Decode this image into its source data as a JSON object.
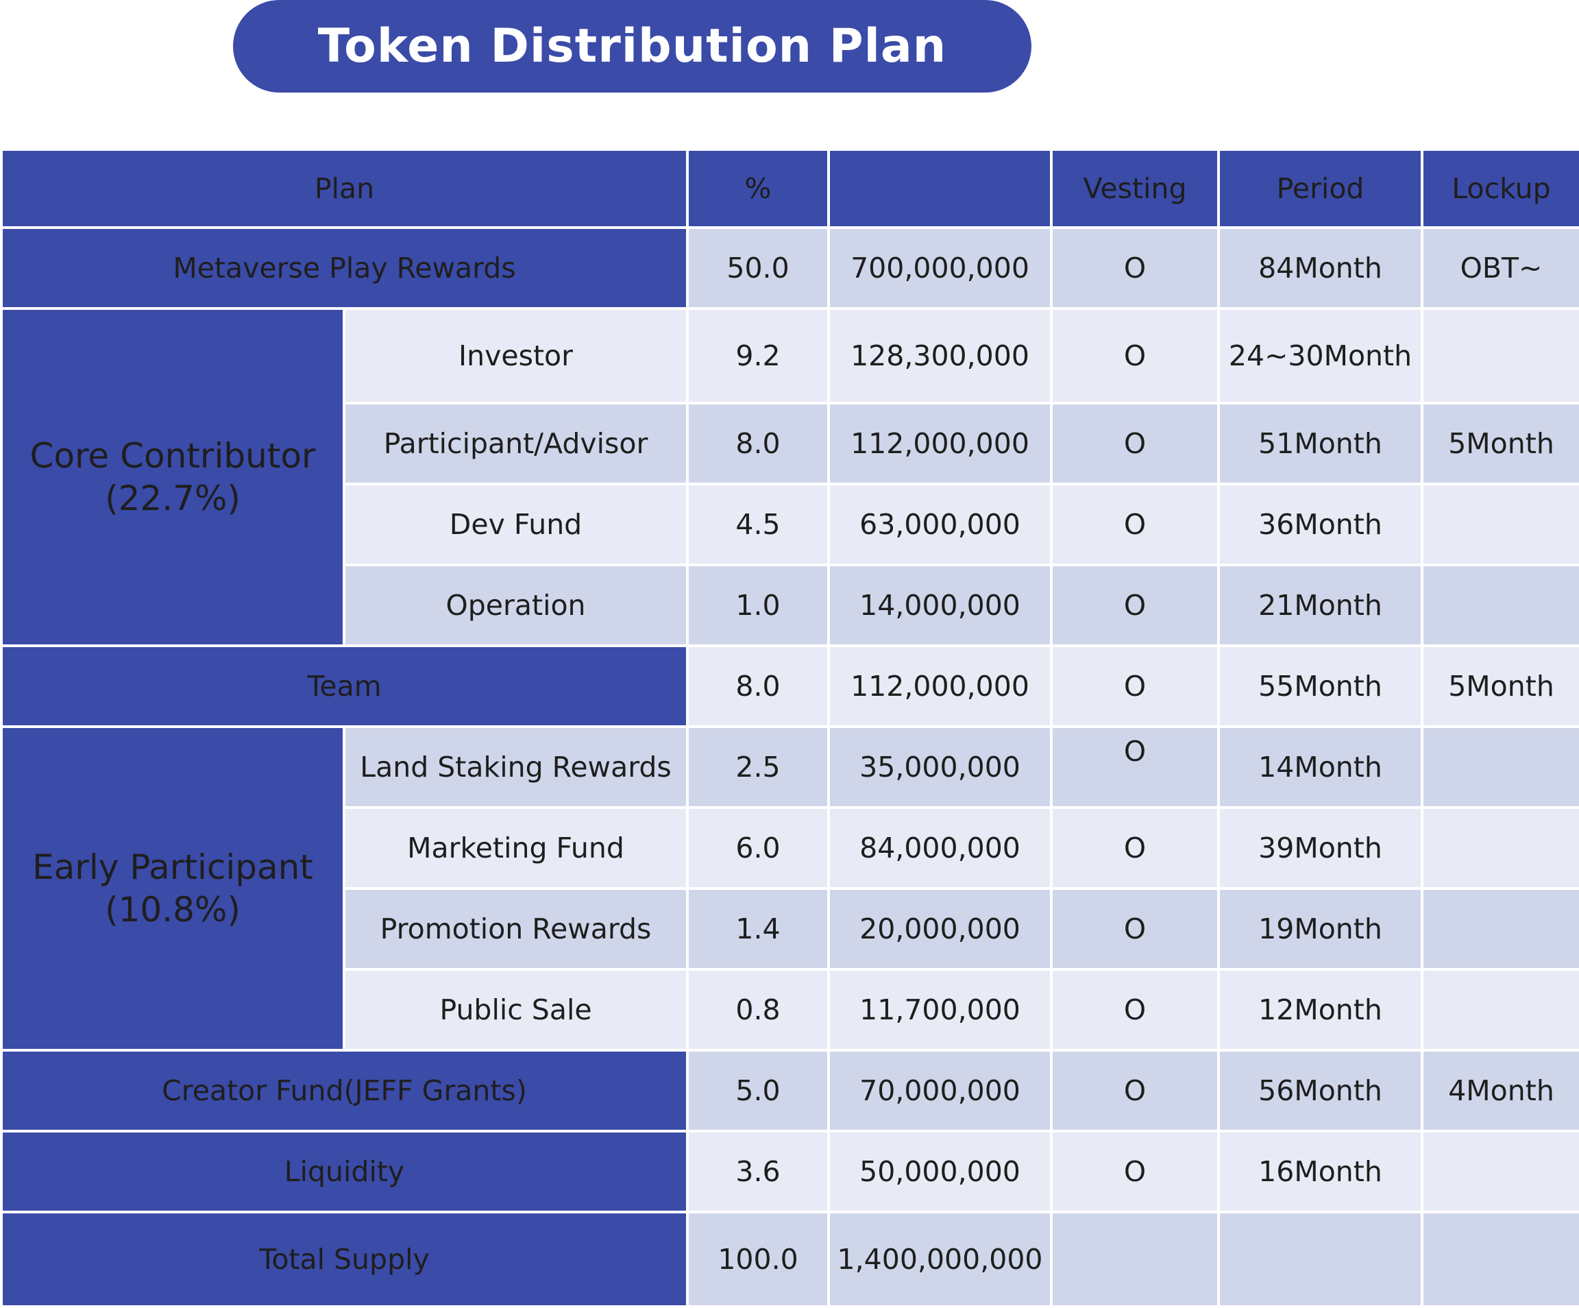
{
  "title": "Token Distribution Plan",
  "header": {
    "plan": "Plan",
    "percent": "%",
    "amount": "",
    "vesting": "Vesting",
    "period": "Period",
    "lockup": "Lockup"
  },
  "rows": {
    "metaverse": {
      "label": "Metaverse Play Rewards",
      "percent": "50.0",
      "amount": "700,000,000",
      "vesting": "O",
      "period": "84Month",
      "lockup": "OBT~"
    },
    "core": {
      "label_line1": "Core Contributor",
      "label_line2": "(22.7%)"
    },
    "investor": {
      "label": "Investor",
      "percent": "9.2",
      "amount": "128,300,000",
      "vesting": "O",
      "period": "24~30Month",
      "lockup": ""
    },
    "participant_advisor": {
      "label": "Participant/Advisor",
      "percent": "8.0",
      "amount": "112,000,000",
      "vesting": "O",
      "period": "51Month",
      "lockup": "5Month"
    },
    "dev_fund": {
      "label": "Dev Fund",
      "percent": "4.5",
      "amount": "63,000,000",
      "vesting": "O",
      "period": "36Month",
      "lockup": ""
    },
    "operation": {
      "label": "Operation",
      "percent": "1.0",
      "amount": "14,000,000",
      "vesting": "O",
      "period": "21Month",
      "lockup": ""
    },
    "team": {
      "label": "Team",
      "percent": "8.0",
      "amount": "112,000,000",
      "vesting": "O",
      "period": "55Month",
      "lockup": "5Month"
    },
    "early": {
      "label_line1": "Early Participant",
      "label_line2": "(10.8%)"
    },
    "land_staking": {
      "label": "Land Staking Rewards",
      "percent": "2.5",
      "amount": "35,000,000",
      "vesting": "O",
      "period": "14Month",
      "lockup": ""
    },
    "marketing_fund": {
      "label": "Marketing Fund",
      "percent": "6.0",
      "amount": "84,000,000",
      "vesting": "O",
      "period": "39Month",
      "lockup": ""
    },
    "promotion_rewards": {
      "label": "Promotion Rewards",
      "percent": "1.4",
      "amount": "20,000,000",
      "vesting": "O",
      "period": "19Month",
      "lockup": ""
    },
    "public_sale": {
      "label": "Public Sale",
      "percent": "0.8",
      "amount": "11,700,000",
      "vesting": "O",
      "period": "12Month",
      "lockup": ""
    },
    "creator_fund": {
      "label": "Creator Fund(JEFF Grants)",
      "percent": "5.0",
      "amount": "70,000,000",
      "vesting": "O",
      "period": "56Month",
      "lockup": "4Month"
    },
    "liquidity": {
      "label": "Liquidity",
      "percent": "3.6",
      "amount": "50,000,000",
      "vesting": "O",
      "period": "16Month",
      "lockup": ""
    },
    "total": {
      "label": "Total Supply",
      "percent": "100.0",
      "amount": "1,400,000,000",
      "vesting": "",
      "period": "",
      "lockup": ""
    }
  },
  "colors": {
    "header_blue": "#3b4ba8",
    "row_dark": "#d0d6ea",
    "row_light": "#e8ebf5"
  }
}
